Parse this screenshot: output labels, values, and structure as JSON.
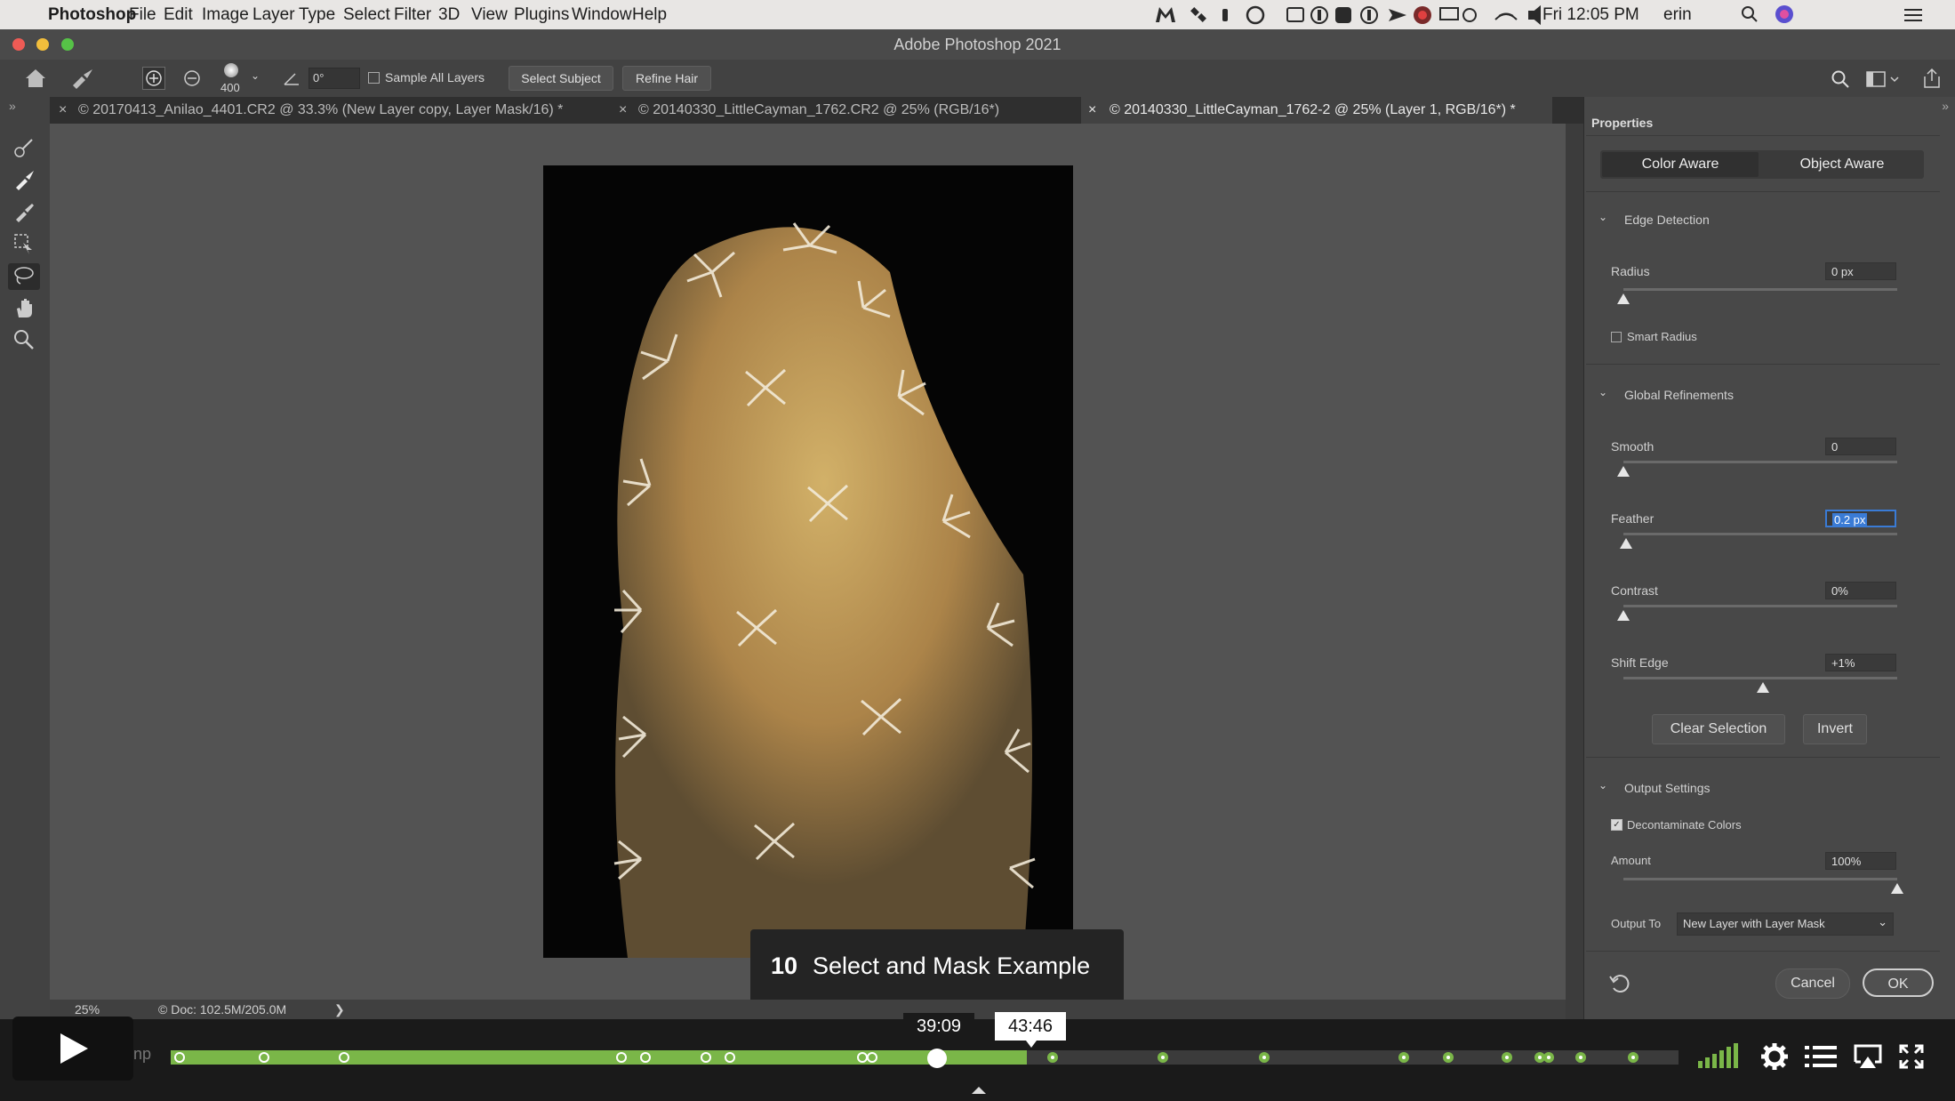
{
  "menubar": {
    "app": "Photoshop",
    "items": [
      "File",
      "Edit",
      "Image",
      "Layer",
      "Type",
      "Select",
      "Filter",
      "3D",
      "View",
      "Plugins",
      "Window",
      "Help"
    ],
    "clock": "Fri 12:05 PM",
    "user": "erin"
  },
  "window": {
    "title": "Adobe Photoshop 2021"
  },
  "options": {
    "brush_size": "400",
    "angle": "0°",
    "sample_all_layers": "Sample All Layers",
    "select_subject": "Select Subject",
    "refine_hair": "Refine Hair"
  },
  "tabs": [
    "© 20170413_Anilao_4401.CR2 @ 33.3% (New Layer copy, Layer Mask/16) *",
    "© 20140330_LittleCayman_1762.CR2 @ 25% (RGB/16*)",
    "© 20140330_LittleCayman_1762-2 @ 25% (Layer 1, RGB/16*) *"
  ],
  "status": {
    "zoom": "25%",
    "doc": "© Doc: 102.5M/205.0M",
    "arrow": "❯"
  },
  "properties": {
    "panel_title": "Properties",
    "mode_buttons": [
      "Color Aware",
      "Object Aware"
    ],
    "edge_detection": {
      "title": "Edge Detection",
      "radius_label": "Radius",
      "radius_value": "0 px",
      "radius_pos": 0,
      "smart_radius": "Smart Radius"
    },
    "global_refinements": {
      "title": "Global Refinements",
      "smooth_label": "Smooth",
      "smooth_value": "0",
      "smooth_pos": 0,
      "feather_label": "Feather",
      "feather_value": "0.2 px",
      "feather_pos": 0.01,
      "contrast_label": "Contrast",
      "contrast_value": "0%",
      "contrast_pos": 0,
      "shift_label": "Shift Edge",
      "shift_value": "+1%",
      "shift_pos": 0.51
    },
    "clear_selection": "Clear Selection",
    "invert": "Invert",
    "output_settings": {
      "title": "Output Settings",
      "decontaminate": "Decontaminate Colors",
      "amount_label": "Amount",
      "amount_value": "100%",
      "amount_pos": 1.0,
      "output_to_label": "Output To",
      "output_to_value": "New Layer with Layer Mask"
    },
    "cancel": "Cancel",
    "ok": "OK"
  },
  "video": {
    "chapter_number": "10",
    "chapter_title": "Select and Mask Example",
    "current_time": "39:09",
    "hover_time": "43:46",
    "progress_fraction": 0.508,
    "buffered_fraction": 0.568,
    "accent_color": "#7ab648",
    "chapter_positions": [
      0.006,
      0.062,
      0.115,
      0.299,
      0.315,
      0.355,
      0.371,
      0.459,
      0.465,
      0.585,
      0.658,
      0.725,
      0.818,
      0.847,
      0.886,
      0.908,
      0.914,
      0.935,
      0.97
    ],
    "icons": [
      "play-icon",
      "volume-bars-icon",
      "gear-icon",
      "list-icon",
      "airplay-icon",
      "fullscreen-icon"
    ]
  }
}
